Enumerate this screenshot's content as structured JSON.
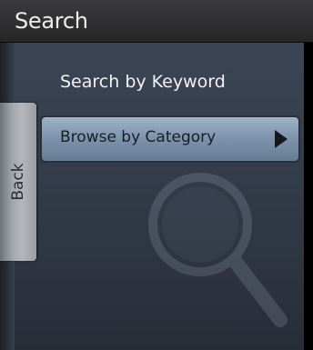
{
  "header": {
    "title": "Search"
  },
  "sidebar": {
    "back_label": "Back"
  },
  "menu": {
    "items": [
      {
        "label": "Search by Keyword",
        "selected": false
      },
      {
        "label": "Browse by Category",
        "selected": true,
        "icon": "chevron-right-icon"
      }
    ]
  },
  "background": {
    "icon": "magnifying-glass-icon"
  },
  "colors": {
    "title_bar": "#2f2f31",
    "panel": "#343d4b",
    "selected_item": "#7f95ad",
    "back_tab": "#a4a8ad"
  }
}
